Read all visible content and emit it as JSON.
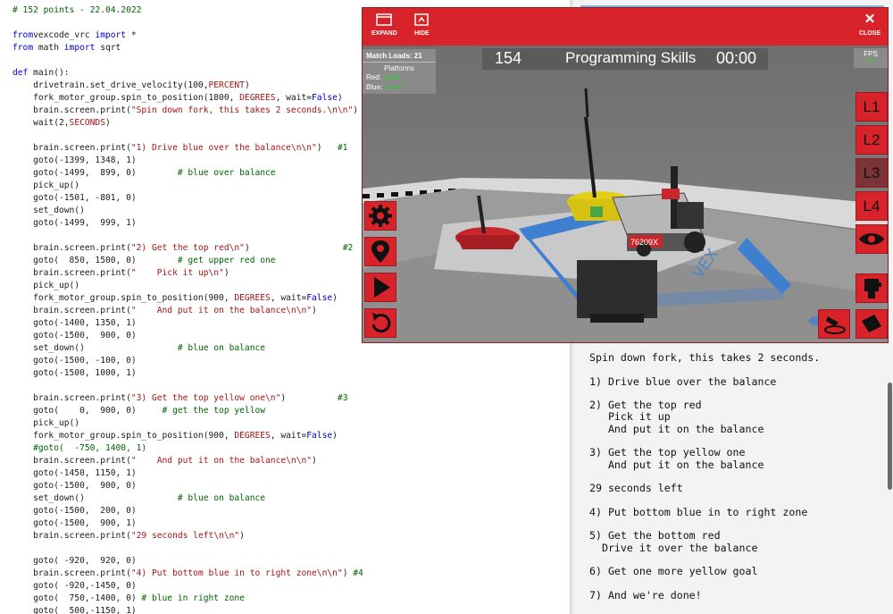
{
  "code_lines": [
    [
      [
        "cm",
        "# 152 points - 22.04.2022"
      ]
    ],
    [],
    [
      [
        "kw",
        "from"
      ],
      [
        "",
        "vexcode_vrc "
      ],
      [
        "kw",
        "import"
      ],
      [
        "",
        " *"
      ]
    ],
    [
      [
        "kw",
        "from"
      ],
      [
        "",
        " math "
      ],
      [
        "kw",
        "import"
      ],
      [
        "",
        " sqrt"
      ]
    ],
    [],
    [
      [
        "kw",
        "def"
      ],
      [
        "",
        " main():"
      ]
    ],
    [
      [
        "",
        "    drivetrain.set_drive_velocity(100,"
      ],
      [
        "cst",
        "PERCENT"
      ],
      [
        "",
        ")"
      ]
    ],
    [
      [
        "",
        "    fork_motor_group.spin_to_position(1800, "
      ],
      [
        "cst",
        "DEGREES"
      ],
      [
        "",
        ", wait="
      ],
      [
        "kw",
        "False"
      ],
      [
        "",
        ")"
      ]
    ],
    [
      [
        "",
        "    brain.screen.print("
      ],
      [
        "str",
        "\"Spin down fork, this takes 2 seconds.\\n\\n\""
      ],
      [
        "",
        ")"
      ]
    ],
    [
      [
        "",
        "    wait(2,"
      ],
      [
        "cst",
        "SECONDS"
      ],
      [
        "",
        ")"
      ]
    ],
    [],
    [
      [
        "",
        "    brain.screen.print("
      ],
      [
        "str",
        "\"1) Drive blue over the balance\\n\\n\""
      ],
      [
        "",
        ")   "
      ],
      [
        "cm",
        "#1"
      ]
    ],
    [
      [
        "",
        "    goto(-1399, 1348, 1)"
      ]
    ],
    [
      [
        "",
        "    goto(-1499,  899, 0)        "
      ],
      [
        "cm",
        "# blue over balance"
      ]
    ],
    [
      [
        "",
        "    pick_up()"
      ]
    ],
    [
      [
        "",
        "    goto(-1501, -801, 0)"
      ]
    ],
    [
      [
        "",
        "    set_down()"
      ]
    ],
    [
      [
        "",
        "    goto(-1499,  999, 1)"
      ]
    ],
    [],
    [
      [
        "",
        "    brain.screen.print("
      ],
      [
        "str",
        "\"2) Get the top red\\n\""
      ],
      [
        "",
        ")                  "
      ],
      [
        "cm",
        "#2"
      ]
    ],
    [
      [
        "",
        "    goto(  850, 1500, 0)        "
      ],
      [
        "cm",
        "# get upper red one"
      ]
    ],
    [
      [
        "",
        "    brain.screen.print("
      ],
      [
        "str",
        "\"    Pick it up\\n\""
      ],
      [
        "",
        ")"
      ]
    ],
    [
      [
        "",
        "    pick_up()"
      ]
    ],
    [
      [
        "",
        "    fork_motor_group.spin_to_position(900, "
      ],
      [
        "cst",
        "DEGREES"
      ],
      [
        "",
        ", wait="
      ],
      [
        "kw",
        "False"
      ],
      [
        "",
        ")"
      ]
    ],
    [
      [
        "",
        "    brain.screen.print("
      ],
      [
        "str",
        "\"    And put it on the balance\\n\\n\""
      ],
      [
        "",
        ")"
      ]
    ],
    [
      [
        "",
        "    goto(-1400, 1350, 1)"
      ]
    ],
    [
      [
        "",
        "    goto(-1500,  900, 0)"
      ]
    ],
    [
      [
        "",
        "    set_down()                  "
      ],
      [
        "cm",
        "# blue on balance"
      ]
    ],
    [
      [
        "",
        "    goto(-1500, -100, 0)"
      ]
    ],
    [
      [
        "",
        "    goto(-1500, 1000, 1)"
      ]
    ],
    [],
    [
      [
        "",
        "    brain.screen.print("
      ],
      [
        "str",
        "\"3) Get the top yellow one\\n\""
      ],
      [
        "",
        ")          "
      ],
      [
        "cm",
        "#3"
      ]
    ],
    [
      [
        "",
        "    goto(    0,  900, 0)     "
      ],
      [
        "cm",
        "# get the top yellow"
      ]
    ],
    [
      [
        "",
        "    pick_up()"
      ]
    ],
    [
      [
        "",
        "    fork_motor_group.spin_to_position(900, "
      ],
      [
        "cst",
        "DEGREES"
      ],
      [
        "",
        ", wait="
      ],
      [
        "kw",
        "False"
      ],
      [
        "",
        ")"
      ]
    ],
    [
      [
        "cm",
        "    #goto(  -750, 1400, 1)"
      ]
    ],
    [
      [
        "",
        "    brain.screen.print("
      ],
      [
        "str",
        "\"    And put it on the balance\\n\\n\""
      ],
      [
        "",
        ")"
      ]
    ],
    [
      [
        "",
        "    goto(-1450, 1150, 1)"
      ]
    ],
    [
      [
        "",
        "    goto(-1500,  900, 0)"
      ]
    ],
    [
      [
        "",
        "    set_down()                  "
      ],
      [
        "cm",
        "# blue on balance"
      ]
    ],
    [
      [
        "",
        "    goto(-1500,  200, 0)"
      ]
    ],
    [
      [
        "",
        "    goto(-1500,  900, 1)"
      ]
    ],
    [
      [
        "",
        "    brain.screen.print("
      ],
      [
        "str",
        "\"29 seconds left\\n\\n\""
      ],
      [
        "",
        ")"
      ]
    ],
    [],
    [
      [
        "",
        "    goto( -920,  920, 0)"
      ]
    ],
    [
      [
        "",
        "    brain.screen.print("
      ],
      [
        "str",
        "\"4) Put bottom blue in to right zone\\n\\n\""
      ],
      [
        "",
        ") "
      ],
      [
        "cm",
        "#4"
      ]
    ],
    [
      [
        "",
        "    goto( -920,-1450, 0)"
      ]
    ],
    [
      [
        "",
        "    goto(  750,-1400, 0) "
      ],
      [
        "cm",
        "# blue in right zone"
      ]
    ],
    [
      [
        "",
        "    goto(  500,-1150, 1)"
      ]
    ]
  ],
  "console": {
    "lines": [
      "Spin down fork, this takes 2 seconds.",
      "",
      "1) Drive blue over the balance",
      "",
      "2) Get the top red",
      "   Pick it up",
      "   And put it on the balance",
      "",
      "3) Get the top yellow one",
      "   And put it on the balance",
      "",
      "29 seconds left",
      "",
      "4) Put bottom blue in to right zone",
      "",
      "5) Get the bottom red",
      "  Drive it over the balance",
      "",
      "6) Get one more yellow goal",
      "",
      "7) And we're done!"
    ]
  },
  "sim": {
    "expand_label": "EXPAND",
    "hide_label": "HIDE",
    "close_label": "CLOSE",
    "close_glyph": "✕",
    "score": "154",
    "mode": "Programming Skills",
    "timer": "00:00",
    "match_loads": "Match Loads: 21",
    "platforms": "Platforms",
    "red_label": "Red:",
    "red_value": "Level",
    "blue_label": "Blue:",
    "blue_value": "Level",
    "fps_label": "FPS",
    "fps_value": "60",
    "robot_number": "76209X",
    "field_text": "VEX",
    "level_buttons": [
      "L1",
      "L2",
      "L3",
      "L4"
    ],
    "accent_color": "#d8232a"
  }
}
